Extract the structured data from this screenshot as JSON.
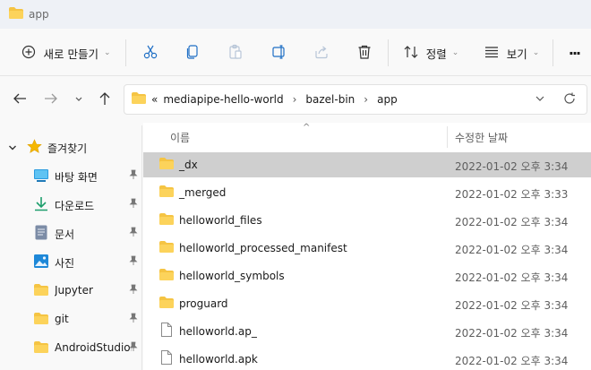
{
  "window": {
    "title": "app"
  },
  "toolbar": {
    "new_label": "새로 만들기",
    "sort_label": "정렬",
    "view_label": "보기",
    "more_label": "···"
  },
  "address": {
    "overflow": "«",
    "crumbs": [
      "mediapipe-hello-world",
      "bazel-bin",
      "app"
    ]
  },
  "sidebar": {
    "quick_access": "즐겨찾기",
    "items": [
      {
        "label": "바탕 화면",
        "icon": "desktop-icon"
      },
      {
        "label": "다운로드",
        "icon": "download-icon"
      },
      {
        "label": "문서",
        "icon": "document-icon"
      },
      {
        "label": "사진",
        "icon": "pictures-icon"
      },
      {
        "label": "Jupyter",
        "icon": "folder-icon"
      },
      {
        "label": "git",
        "icon": "folder-icon"
      },
      {
        "label": "AndroidStudioP",
        "icon": "folder-icon"
      }
    ]
  },
  "columns": {
    "name": "이름",
    "date": "수정한 날짜"
  },
  "files": [
    {
      "name": "_dx",
      "date": "2022-01-02 오후 3:34",
      "type": "folder",
      "selected": true
    },
    {
      "name": "_merged",
      "date": "2022-01-02 오후 3:33",
      "type": "folder"
    },
    {
      "name": "helloworld_files",
      "date": "2022-01-02 오후 3:34",
      "type": "folder"
    },
    {
      "name": "helloworld_processed_manifest",
      "date": "2022-01-02 오후 3:34",
      "type": "folder"
    },
    {
      "name": "helloworld_symbols",
      "date": "2022-01-02 오후 3:34",
      "type": "folder"
    },
    {
      "name": "proguard",
      "date": "2022-01-02 오후 3:34",
      "type": "folder"
    },
    {
      "name": "helloworld.ap_",
      "date": "2022-01-02 오후 3:34",
      "type": "file"
    },
    {
      "name": "helloworld.apk",
      "date": "2022-01-02 오후 3:34",
      "type": "file"
    }
  ],
  "colors": {
    "folder": "#f5c443",
    "accent": "#0067c0",
    "selected_row": "#cfcfcf"
  }
}
